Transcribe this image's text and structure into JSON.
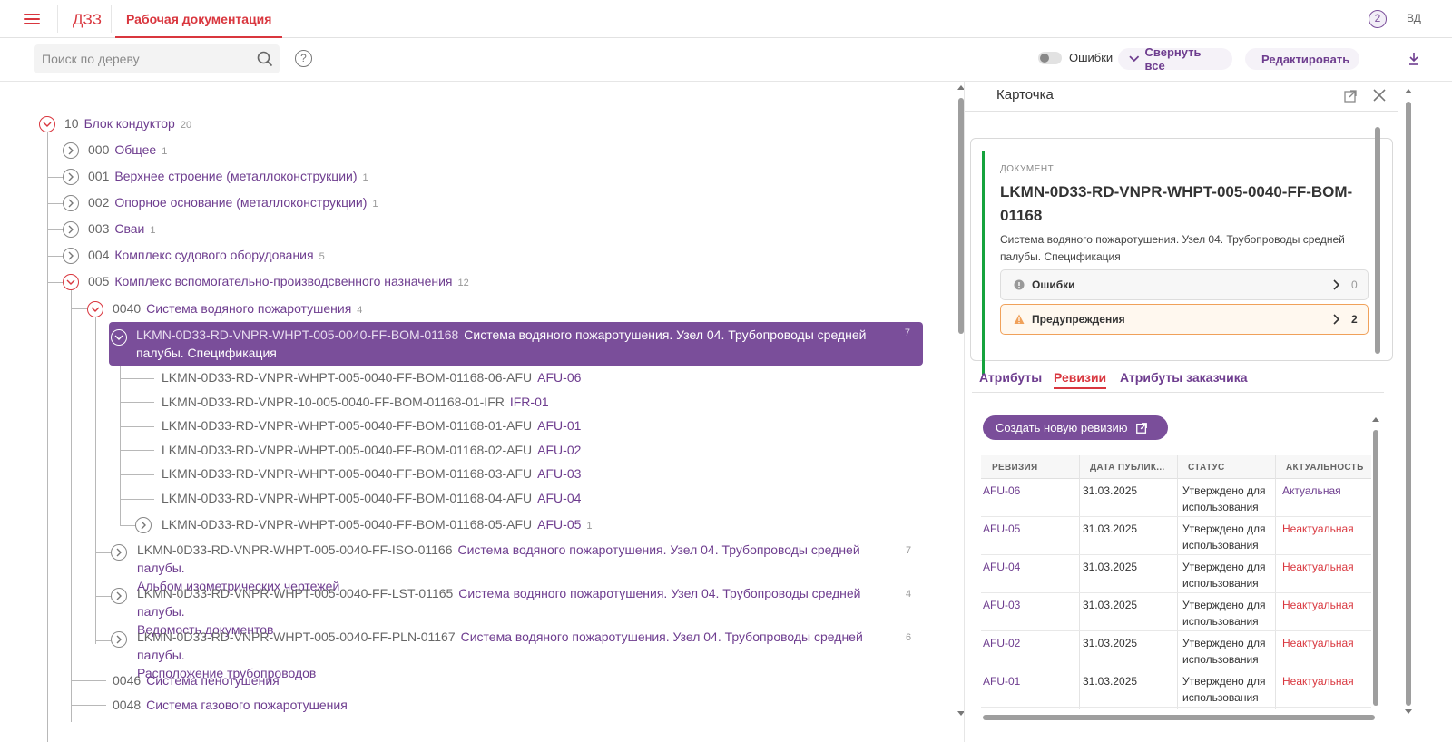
{
  "header": {
    "app_name": "ДЗЗ",
    "tab_label": "Рабочая документация",
    "help_badge": "2",
    "avatar": "ВД"
  },
  "toolbar": {
    "search_placeholder": "Поиск по дереву",
    "help": "?",
    "errors_toggle": "Ошибки",
    "collapse_all": "Свернуть все",
    "edit": "Редактировать"
  },
  "tree": {
    "root": {
      "code": "10",
      "name": "Блок кондуктор",
      "count": "20"
    },
    "level1": [
      {
        "code": "000",
        "name": "Общее",
        "count": "1"
      },
      {
        "code": "001",
        "name": "Верхнее строение (металлоконструкции)",
        "count": "1"
      },
      {
        "code": "002",
        "name": "Опорное основание (металлоконструкции)",
        "count": "1"
      },
      {
        "code": "003",
        "name": "Сваи",
        "count": "1"
      },
      {
        "code": "004",
        "name": "Комплекс судового оборудования",
        "count": "5"
      },
      {
        "code": "005",
        "name": "Комплекс вспомогательно-производсвенного назначения",
        "count": "12"
      }
    ],
    "level2_open": {
      "code": "0040",
      "name": "Система водяного пожаротушения",
      "count": "4"
    },
    "selected": {
      "code": "LKMN-0D33-RD-VNPR-WHPT-005-0040-FF-BOM-01168",
      "name": "Система водяного пожаротушения. Узел 04. Трубопроводы средней палубы. Спецификация",
      "count": "7"
    },
    "revisions": [
      {
        "code": "LKMN-0D33-RD-VNPR-WHPT-005-0040-FF-BOM-01168-06-AFU",
        "name": "AFU-06"
      },
      {
        "code": "LKMN-0D33-RD-VNPR-10-005-0040-FF-BOM-01168-01-IFR",
        "name": "IFR-01"
      },
      {
        "code": "LKMN-0D33-RD-VNPR-WHPT-005-0040-FF-BOM-01168-01-AFU",
        "name": "AFU-01"
      },
      {
        "code": "LKMN-0D33-RD-VNPR-WHPT-005-0040-FF-BOM-01168-02-AFU",
        "name": "AFU-02"
      },
      {
        "code": "LKMN-0D33-RD-VNPR-WHPT-005-0040-FF-BOM-01168-03-AFU",
        "name": "AFU-03"
      },
      {
        "code": "LKMN-0D33-RD-VNPR-WHPT-005-0040-FF-BOM-01168-04-AFU",
        "name": "AFU-04"
      },
      {
        "code": "LKMN-0D33-RD-VNPR-WHPT-005-0040-FF-BOM-01168-05-AFU",
        "name": "AFU-05",
        "count": "1"
      }
    ],
    "siblings": [
      {
        "code": "LKMN-0D33-RD-VNPR-WHPT-005-0040-FF-ISO-01166",
        "name": "Система водяного пожаротушения. Узел 04. Трубопроводы средней палубы.",
        "name2": "Альбом изометрических чертежей",
        "count": "7"
      },
      {
        "code": "LKMN-0D33-RD-VNPR-WHPT-005-0040-FF-LST-01165",
        "name": "Система водяного пожаротушения. Узел 04. Трубопроводы средней палубы.",
        "name2": "Ведомость документов",
        "count": "4"
      },
      {
        "code": "LKMN-0D33-RD-VNPR-WHPT-005-0040-FF-PLN-01167",
        "name": "Система водяного пожаротушения. Узел 04. Трубопроводы средней палубы.",
        "name2": "Расположение трубопроводов",
        "count": "6"
      }
    ],
    "level2_more": [
      {
        "code": "0046",
        "name": "Система пенотушения"
      },
      {
        "code": "0048",
        "name": "Система газового пожаротушения"
      }
    ]
  },
  "panel": {
    "title": "Карточка",
    "doc_label": "ДОКУМЕНТ",
    "doc_code": "LKMN-0D33-RD-VNPR-WHPT-005-0040-FF-BOM-01168",
    "doc_desc": "Система водяного пожаротушения. Узел 04. Трубопроводы средней палубы. Спецификация",
    "errors": {
      "label": "Ошибки",
      "count": "0"
    },
    "warnings": {
      "label": "Предупреждения",
      "count": "2"
    },
    "tabs": [
      "Атрибуты",
      "Ревизии",
      "Атрибуты заказчика"
    ],
    "create_btn": "Создать новую ревизию",
    "table": {
      "headers": [
        "РЕВИЗИЯ",
        "ДАТА ПУБЛИК...",
        "СТАТУС",
        "АКТУАЛЬНОСТЬ"
      ],
      "rows": [
        {
          "rev": "AFU-06",
          "date": "31.03.2025",
          "status": "Утверждено для использования",
          "actual": "Актуальная"
        },
        {
          "rev": "AFU-05",
          "date": "31.03.2025",
          "status": "Утверждено для использования",
          "actual": "Неактуальная"
        },
        {
          "rev": "AFU-04",
          "date": "31.03.2025",
          "status": "Утверждено для использования",
          "actual": "Неактуальная"
        },
        {
          "rev": "AFU-03",
          "date": "31.03.2025",
          "status": "Утверждено для использования",
          "actual": "Неактуальная"
        },
        {
          "rev": "AFU-02",
          "date": "31.03.2025",
          "status": "Утверждено для использования",
          "actual": "Неактуальная"
        },
        {
          "rev": "AFU-01",
          "date": "31.03.2025",
          "status": "Утверждено для использования",
          "actual": "Неактуальная"
        }
      ]
    }
  },
  "colors": {
    "accent_red": "#d9363e",
    "accent_purple": "#7a4e9a",
    "success_green": "#15a33d",
    "warning_orange": "#f0a15a"
  }
}
